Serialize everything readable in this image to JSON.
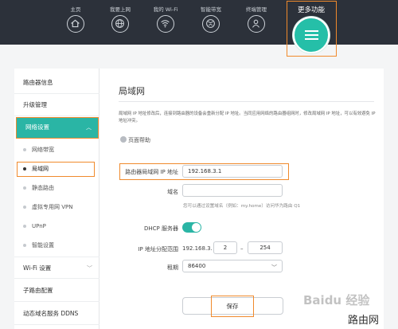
{
  "nav": {
    "items": [
      {
        "label": "主页",
        "icon": "home-icon"
      },
      {
        "label": "我要上网",
        "icon": "globe-icon"
      },
      {
        "label": "我的 Wi-Fi",
        "icon": "wifi-icon"
      },
      {
        "label": "智能带宽",
        "icon": "bandwidth-globe-icon"
      },
      {
        "label": "终端管理",
        "icon": "user-icon"
      }
    ],
    "more_label": "更多功能",
    "more_icon": "menu-icon"
  },
  "sidebar": {
    "items": [
      {
        "label": "路由器信息"
      },
      {
        "label": "升级管理"
      },
      {
        "label": "网络设置",
        "active": true
      },
      {
        "label": "网络带宽"
      },
      {
        "label": "局域网",
        "current": true
      },
      {
        "label": "静态路由"
      },
      {
        "label": "虚拟专用网 VPN"
      },
      {
        "label": "UPnP"
      },
      {
        "label": "智能设置"
      },
      {
        "label": "Wi-Fi 设置"
      },
      {
        "label": "子路由配置"
      },
      {
        "label": "动态域名服务 DDNS"
      }
    ]
  },
  "main": {
    "title": "局域网",
    "description": "局域网 IP 地址修改后，连接到路由器的设备会重新分配 IP 地址。当同应用网络的路由器组网时，修改局域网 IP 地址，可以有效避免 IP 地址冲突。",
    "help": "页面帮助",
    "form": {
      "ip_label": "路由器局域网 IP 地址",
      "ip_value": "192.168.3.1",
      "domain_label": "域名",
      "domain_value": "",
      "domain_hint": "您可以通过设置域名（例如：my.home）访问华为路由 Q1",
      "dhcp_label": "DHCP 服务器",
      "dhcp_enabled": true,
      "range_label": "IP 地址分配范围",
      "range_prefix": "192.168.3.",
      "range_start": "2",
      "range_dash": "–",
      "range_end": "254",
      "lease_label": "租期",
      "lease_value": "86400"
    },
    "save_label": "保存"
  },
  "watermark": {
    "baidu": "Baidu 经验",
    "site": "路由网"
  },
  "colors": {
    "accent": "#2ab5a5",
    "highlight": "#f08a2c",
    "topbar": "#2c313a"
  }
}
